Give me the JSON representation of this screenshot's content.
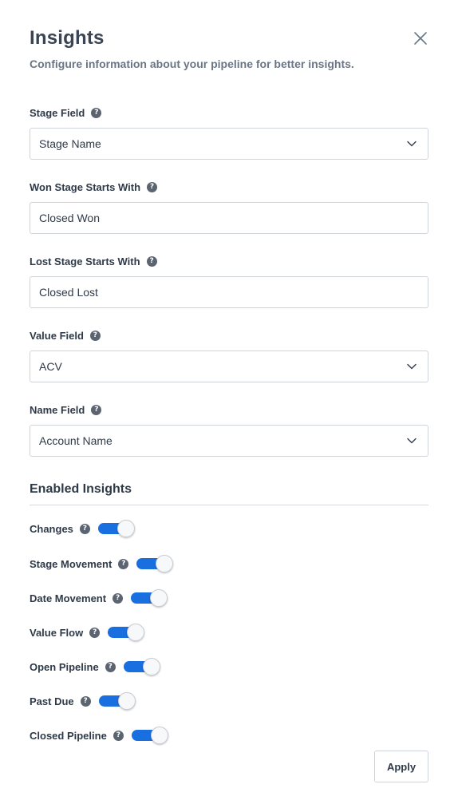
{
  "header": {
    "title": "Insights",
    "subtitle": "Configure information about your pipeline for better insights."
  },
  "help_glyph": "?",
  "fields": {
    "stage_field": {
      "label": "Stage Field",
      "value": "Stage Name"
    },
    "won_stage": {
      "label": "Won Stage Starts With",
      "value": "Closed Won"
    },
    "lost_stage": {
      "label": "Lost Stage Starts With",
      "value": "Closed Lost"
    },
    "value_field": {
      "label": "Value Field",
      "value": "ACV"
    },
    "name_field": {
      "label": "Name Field",
      "value": "Account Name"
    }
  },
  "enabled_insights": {
    "title": "Enabled Insights",
    "items": [
      {
        "label": "Changes",
        "enabled": true
      },
      {
        "label": "Stage Movement",
        "enabled": true
      },
      {
        "label": "Date Movement",
        "enabled": true
      },
      {
        "label": "Value Flow",
        "enabled": true
      },
      {
        "label": "Open Pipeline",
        "enabled": true
      },
      {
        "label": "Past Due",
        "enabled": true
      },
      {
        "label": "Closed Pipeline",
        "enabled": true
      }
    ]
  },
  "footer": {
    "apply_label": "Apply"
  },
  "colors": {
    "toggle_on": "#1a6fe0",
    "text": "#2f3a48",
    "muted": "#6b7685"
  },
  "icons": {
    "close": "close-icon",
    "dropdown": "chevron-down-icon",
    "help": "help-icon"
  }
}
